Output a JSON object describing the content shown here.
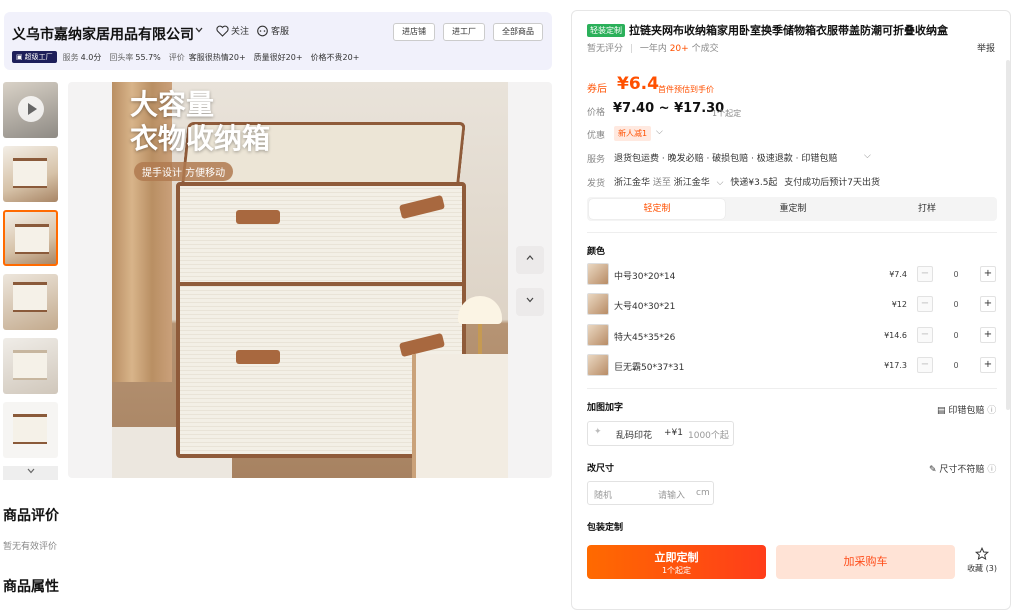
{
  "shop": {
    "name": "义乌市嘉纳家居用品有限公司",
    "follow_label": "关注",
    "service_label": "客服",
    "buttons": [
      "进店铺",
      "进工厂",
      "全部商品"
    ],
    "badge": "超级工厂",
    "metrics": [
      {
        "label": "服务",
        "value": "4.0分"
      },
      {
        "label": "回头率",
        "value": "55.7%"
      },
      {
        "label": "评价",
        "value": ""
      }
    ],
    "tags": [
      "客服很热情20+",
      "质量很好20+",
      "价格不贵20+"
    ]
  },
  "gallery": {
    "headline_line1": "大容量",
    "headline_line2": "衣物收纳箱",
    "subline": "提手设计 方便移动",
    "thumb_count": 7,
    "selected_thumb": 3
  },
  "reviews": {
    "title": "商品评价",
    "empty_text": "暂无有效评价",
    "attributes_title": "商品属性"
  },
  "product": {
    "tag": "轻装定制",
    "title": "拉链夹网布收纳箱家用卧室换季储物箱衣服带盖防潮可折叠收纳盒",
    "no_rating": "暂无评分",
    "sales_prefix": "一年内",
    "sales_count": "20+",
    "sales_suffix": "个成交",
    "report": "举报",
    "coupon_label": "券后",
    "coupon_price": "¥6.4",
    "coupon_note": "首件预估到手价",
    "price_label": "价格",
    "price_range": "¥7.40 ~ ¥17.30",
    "min_order": "1个起定",
    "promo_label": "优惠",
    "promo": "新人减1",
    "service_label": "服务",
    "services": "退货包运费 · 晚发必赔 · 破损包赔 · 极速退款 · 印错包赔",
    "ship_label": "发货",
    "ship_from": "浙江金华",
    "ship_to_word": "送至",
    "ship_to": "浙江金华",
    "ship_fee": "快递¥3.5起",
    "ship_eta": "支付成功后预计7天出货",
    "tabs": [
      "轻定制",
      "重定制",
      "打样"
    ],
    "active_tab": 0
  },
  "colors": {
    "title": "颜色",
    "items": [
      {
        "name": "中号30*20*14",
        "price": "¥7.4",
        "qty": "0"
      },
      {
        "name": "大号40*30*21",
        "price": "¥12",
        "qty": "0"
      },
      {
        "name": "特大45*35*26",
        "price": "¥14.6",
        "qty": "0"
      },
      {
        "name": "巨无霸50*37*31",
        "price": "¥17.3",
        "qty": "0"
      }
    ]
  },
  "addons": {
    "title": "加图加字",
    "print_guarantee": "印错包赔",
    "option_name": "乱码印花",
    "option_price": "+¥1",
    "option_min": "1000个起"
  },
  "size": {
    "title": "改尺寸",
    "size_guarantee": "尺寸不符赔",
    "field_label": "随机",
    "placeholder": "请输入",
    "unit": "cm"
  },
  "packaging": {
    "title": "包装定制"
  },
  "actions": {
    "primary": "立即定制",
    "primary_sub": "1个起定",
    "secondary": "加采购车",
    "favorite": "收藏 (3)"
  }
}
